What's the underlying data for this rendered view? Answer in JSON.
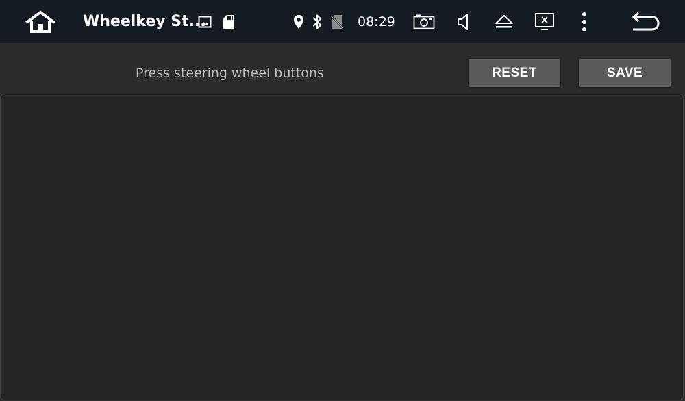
{
  "status_bar": {
    "app_title": "Wheelkey St...",
    "time": "08:29",
    "icons": [
      "home-icon",
      "image-notification-icon",
      "sd-card-icon",
      "location-icon",
      "bluetooth-icon",
      "no-sim-icon",
      "screenshot-icon",
      "volume-icon",
      "eject-icon",
      "close-app-icon",
      "more-menu-icon",
      "back-icon"
    ]
  },
  "main": {
    "instruction": "Press steering wheel buttons",
    "reset_label": "RESET",
    "save_label": "SAVE",
    "key_list": []
  },
  "colors": {
    "status_bar_bg": "#151b22",
    "content_bg": "#2b2b2b",
    "panel_bg": "#252525",
    "button_bg": "#5a5a5a",
    "text_primary": "#ffffff",
    "text_secondary": "#bdbdbd"
  }
}
